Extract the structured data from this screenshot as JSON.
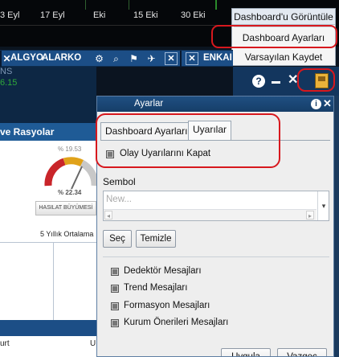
{
  "chart": {
    "axis_labels": [
      "3 Eyl",
      "17 Eyl",
      "Eki",
      "15 Eki",
      "30 Eki"
    ]
  },
  "menu": {
    "header": "Dashboard'u Görüntüle",
    "items": [
      "Dashboard Ayarları",
      "Varsayılan Kaydet"
    ]
  },
  "toolbar": {
    "algyo": "ALGYO",
    "alarko": "ALARKO",
    "enka": "ENKAI",
    "close_symbol": "✕"
  },
  "left_info": {
    "label": "NS",
    "value": "6.15"
  },
  "header_icons": {
    "help": "?",
    "close": "✕"
  },
  "left_panel": {
    "title": "ve Rasyolar",
    "gauge_top": "% 19.53",
    "gauge_bottom": "% 22.34",
    "button": "HASILAT BÜYÜMESİ",
    "five_year": "5 Yıllık Ortalama",
    "bottom_left": "urt",
    "bottom_right": "U"
  },
  "dialog": {
    "title": "Ayarlar",
    "info": "i",
    "close": "✕",
    "tabs": [
      "Dashboard Ayarları",
      "Uyarılar"
    ],
    "active_tab": "Uyarılar",
    "disable_events_label": "Olay Uyarılarını Kapat",
    "sembol_label": "Sembol",
    "combo_placeholder": "New...",
    "select_button": "Seç",
    "clear_button": "Temizle",
    "message_options": [
      "Dedektör Mesajları",
      "Trend Mesajları",
      "Formasyon Mesajları",
      "Kurum Önerileri Mesajları"
    ],
    "apply_button": "Uygula",
    "cancel_button": "Vazgeç"
  },
  "colors": {
    "toolbar_blue": "#1c4e86",
    "dialog_title": "#1f4f82",
    "highlight_red": "#d7181e",
    "value_green": "#2fa83a"
  }
}
